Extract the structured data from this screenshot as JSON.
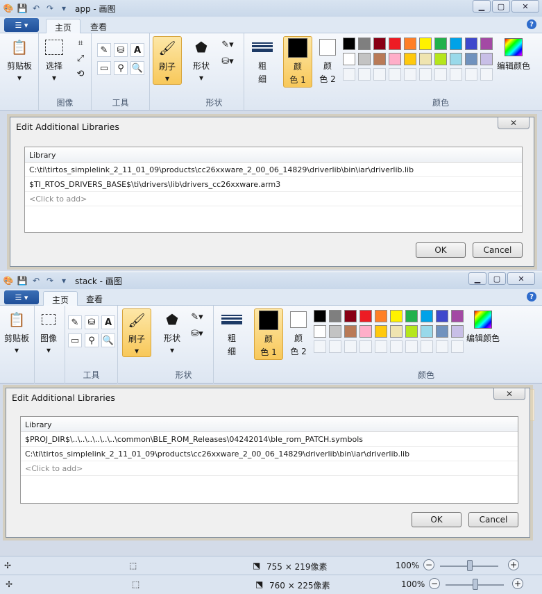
{
  "window1": {
    "title": "app - 画图",
    "tabs": [
      "主页",
      "查看"
    ],
    "ribbon": {
      "clipboard": "剪贴板",
      "select": "选择",
      "image_group": "图像",
      "tools_group": "工具",
      "brush": "刷子",
      "shapes": "形状",
      "shapes_group": "形状",
      "size": "粗\n细",
      "size_line1": "粗",
      "size_line2": "细",
      "color1": "颜\n色 1",
      "color1_line1": "颜",
      "color1_line2": "色 1",
      "color2_line1": "颜",
      "color2_line2": "色 2",
      "edit_colors": "编辑颜色",
      "colors_group": "颜色"
    },
    "dialog": {
      "title": "Edit Additional Libraries",
      "column_header": "Library",
      "rows": [
        "C:\\ti\\tirtos_simplelink_2_11_01_09\\products\\cc26xxware_2_00_06_14829\\driverlib\\bin\\iar\\driverlib.lib",
        "$TI_RTOS_DRIVERS_BASE$\\ti\\drivers\\lib\\drivers_cc26xxware.arm3"
      ],
      "placeholder": "<Click to add>",
      "ok": "OK",
      "cancel": "Cancel"
    }
  },
  "window2": {
    "title": "stack - 画图",
    "tabs": [
      "主页",
      "查看"
    ],
    "ribbon": {
      "clipboard": "剪贴板",
      "image": "图像",
      "tools_group": "工具",
      "brush": "刷子",
      "shapes": "形状",
      "shapes_group": "形状",
      "size_line1": "粗",
      "size_line2": "细",
      "color1_line1": "颜",
      "color1_line2": "色 1",
      "color2_line1": "颜",
      "color2_line2": "色 2",
      "edit_colors": "编辑颜色",
      "colors_group": "颜色"
    },
    "dialog": {
      "title": "Edit Additional Libraries",
      "column_header": "Library",
      "rows": [
        "$PROJ_DIR$\\..\\..\\..\\..\\..\\..\\common\\BLE_ROM_Releases\\04242014\\ble_rom_PATCH.symbols",
        "C:\\ti\\tirtos_simplelink_2_11_01_09\\products\\cc26xxware_2_00_06_14829\\driverlib\\bin\\iar\\driverlib.lib"
      ],
      "placeholder": "<Click to add>",
      "ok": "OK",
      "cancel": "Cancel"
    }
  },
  "status1": {
    "dimensions": "755 × 219像素",
    "zoom": "100%"
  },
  "status2": {
    "dimensions": "760 × 225像素",
    "zoom": "100%"
  },
  "palette": [
    "#000000",
    "#7f7f7f",
    "#880015",
    "#ed1c24",
    "#ff7f27",
    "#fff200",
    "#22b14c",
    "#00a2e8",
    "#3f48cc",
    "#a349a4",
    "#ffffff",
    "#c3c3c3",
    "#b97a57",
    "#ffaec9",
    "#ffc90e",
    "#efe4b0",
    "#b5e61d",
    "#99d9ea",
    "#7092be",
    "#c8bfe7"
  ],
  "accent": "#f8c85a"
}
